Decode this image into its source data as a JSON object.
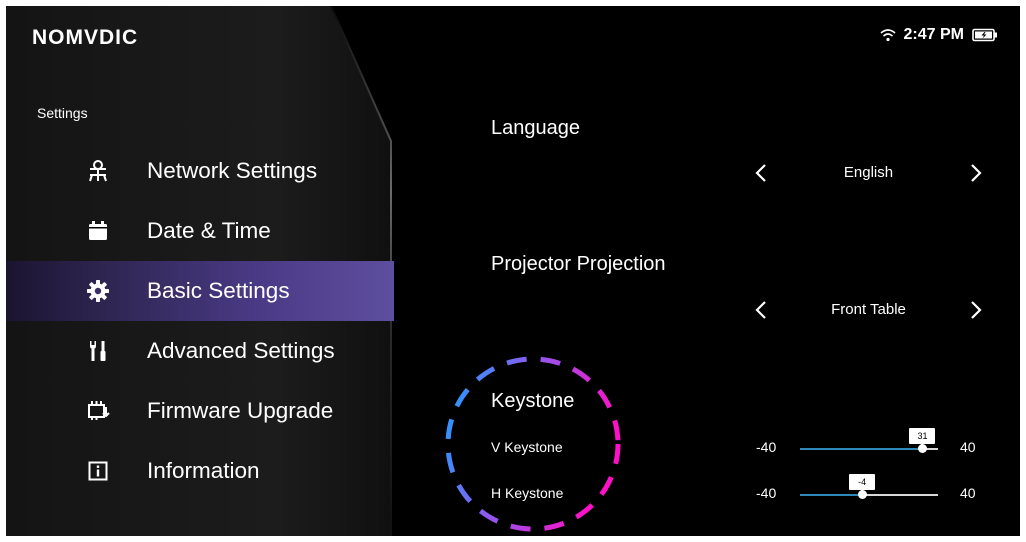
{
  "brand": {
    "logo": "NOMVDIC"
  },
  "status_bar": {
    "time": "2:47 PM",
    "wifi_icon": "wifi-icon",
    "battery_icon": "battery-charging-icon"
  },
  "sidebar": {
    "title": "Settings",
    "items": [
      {
        "label": "Network Settings",
        "icon": "network-icon",
        "active": false
      },
      {
        "label": "Date & Time",
        "icon": "calendar-icon",
        "active": false
      },
      {
        "label": "Basic Settings",
        "icon": "gear-icon",
        "active": true
      },
      {
        "label": "Advanced Settings",
        "icon": "tools-icon",
        "active": false
      },
      {
        "label": "Firmware Upgrade",
        "icon": "firmware-icon",
        "active": false
      },
      {
        "label": "Information",
        "icon": "info-icon",
        "active": false
      }
    ]
  },
  "main": {
    "language": {
      "title": "Language",
      "value": "English"
    },
    "projection": {
      "title": "Projector Projection",
      "value": "Front Table"
    },
    "keystone": {
      "title": "Keystone",
      "v": {
        "label": "V Keystone",
        "min": "-40",
        "max": "40",
        "value": "31"
      },
      "h": {
        "label": "H Keystone",
        "min": "-40",
        "max": "40",
        "value": "-4"
      }
    }
  },
  "colors": {
    "active_item_gradient_end": "#5e4e9e",
    "slider_fill": "#2e89b8",
    "focus_ring_blue": "#1aa3ff",
    "focus_ring_magenta": "#e020e0"
  }
}
